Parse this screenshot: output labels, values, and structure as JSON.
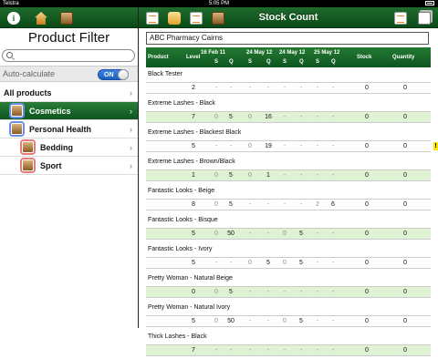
{
  "statusbar": {
    "carrier": "Telstra",
    "time": "5:05 PM"
  },
  "left_panel": {
    "title": "Product Filter",
    "search": {
      "placeholder": "",
      "value": ""
    },
    "autocalc": {
      "label": "Auto-calculate",
      "toggle": "ON"
    },
    "tree": [
      {
        "label": "All products",
        "indent": 0,
        "selected": false,
        "icon": "",
        "icon_ring": ""
      },
      {
        "label": "Cosmetics",
        "indent": 1,
        "selected": true,
        "icon": "box-icon",
        "icon_ring": "blue"
      },
      {
        "label": "Personal Health",
        "indent": 1,
        "selected": false,
        "icon": "box-icon",
        "icon_ring": "blue"
      },
      {
        "label": "Bedding",
        "indent": 2,
        "selected": false,
        "icon": "box-icon",
        "icon_ring": "red"
      },
      {
        "label": "Sport",
        "indent": 2,
        "selected": false,
        "icon": "box-icon",
        "icon_ring": "red"
      }
    ]
  },
  "main": {
    "title": "Stock Count",
    "store": "ABC Pharmacy Cairns",
    "headers": {
      "product": "Product",
      "level": "Level",
      "dates": [
        "16 Feb 11",
        "24 May 12",
        "24 May 12",
        "25 May 12"
      ],
      "sq": [
        "S",
        "Q",
        "S",
        "Q",
        "S",
        "Q",
        "S",
        "Q"
      ],
      "stock": "Stock",
      "quantity": "Quantity"
    },
    "rows": [
      {
        "name": "Black Tester",
        "level": "2",
        "cells": [
          "-",
          "-",
          "-",
          "-",
          "-",
          "-",
          "-",
          "-"
        ],
        "stock": "0",
        "quantity": "0",
        "warn": false
      },
      {
        "name": "Extreme Lashes - Black",
        "level": "7",
        "cells": [
          "0",
          "5",
          "0",
          "16",
          "-",
          "-",
          "-",
          "-"
        ],
        "stock": "0",
        "quantity": "0",
        "warn": false
      },
      {
        "name": "Extreme Lashes - Blackest Black",
        "level": "5",
        "cells": [
          "-",
          "-",
          "0",
          "19",
          "-",
          "-",
          "-",
          "-"
        ],
        "stock": "0",
        "quantity": "0",
        "warn": true
      },
      {
        "name": "Extreme Lashes - Brown/Black",
        "level": "1",
        "cells": [
          "0",
          "5",
          "0",
          "1",
          "-",
          "-",
          "-",
          "-"
        ],
        "stock": "0",
        "quantity": "0",
        "warn": false
      },
      {
        "name": "Fantastic Looks - Beige",
        "level": "8",
        "cells": [
          "0",
          "5",
          "-",
          "-",
          "-",
          "-",
          "2",
          "6"
        ],
        "stock": "0",
        "quantity": "0",
        "warn": false
      },
      {
        "name": "Fantastic Looks - Bisque",
        "level": "5",
        "cells": [
          "0",
          "50",
          "-",
          "-",
          "0",
          "5",
          "-",
          "-"
        ],
        "stock": "0",
        "quantity": "0",
        "warn": false
      },
      {
        "name": "Fantastic Looks - Ivory",
        "level": "5",
        "cells": [
          "-",
          "-",
          "0",
          "5",
          "0",
          "5",
          "-",
          "-"
        ],
        "stock": "0",
        "quantity": "0",
        "warn": false
      },
      {
        "name": "Pretty Woman - Natural Beige",
        "level": "0",
        "cells": [
          "0",
          "5",
          "-",
          "-",
          "-",
          "-",
          "-",
          "-"
        ],
        "stock": "0",
        "quantity": "0",
        "warn": false
      },
      {
        "name": "Pretty Woman - Natural Ivory",
        "level": "5",
        "cells": [
          "0",
          "50",
          "-",
          "-",
          "0",
          "5",
          "-",
          "-"
        ],
        "stock": "0",
        "quantity": "0",
        "warn": false
      },
      {
        "name": "Thick Lashes - Black",
        "level": "7",
        "cells": [
          "-",
          "-",
          "-",
          "-",
          "-",
          "-",
          "-",
          "-"
        ],
        "stock": "0",
        "quantity": "0",
        "warn": false
      }
    ]
  },
  "colors": {
    "bar_green": "#0e5520",
    "row_alt": "#dff3d4",
    "warn_yellow": "#ffe500",
    "toggle_blue": "#1f5fbd"
  }
}
